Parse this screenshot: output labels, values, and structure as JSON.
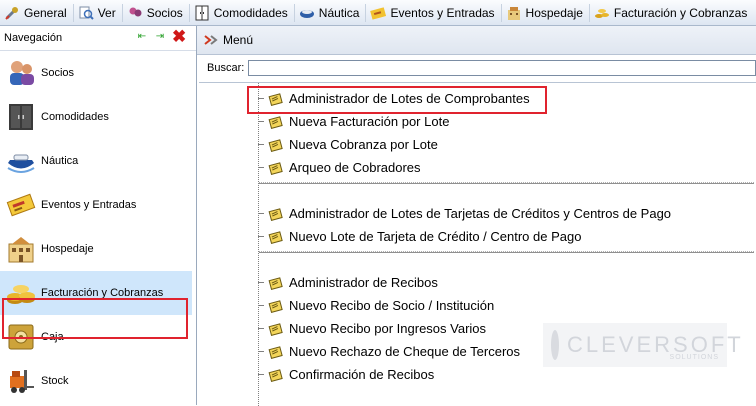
{
  "menubar": {
    "items": [
      {
        "label": "General",
        "icon": "wrench-icon"
      },
      {
        "label": "Ver",
        "icon": "magnifier-icon"
      },
      {
        "label": "Socios",
        "icon": "members-icon"
      },
      {
        "label": "Comodidades",
        "icon": "wardrobe-icon"
      },
      {
        "label": "Náutica",
        "icon": "boat-icon"
      },
      {
        "label": "Eventos y Entradas",
        "icon": "ticket-icon"
      },
      {
        "label": "Hospedaje",
        "icon": "hotel-icon"
      },
      {
        "label": "Facturación y Cobranzas",
        "icon": "coins-icon"
      }
    ]
  },
  "nav": {
    "title": "Navegación",
    "items": [
      {
        "label": "Socios",
        "icon": "members-icon"
      },
      {
        "label": "Comodidades",
        "icon": "wardrobe-icon"
      },
      {
        "label": "Náutica",
        "icon": "boat-icon"
      },
      {
        "label": "Eventos y Entradas",
        "icon": "ticket-icon"
      },
      {
        "label": "Hospedaje",
        "icon": "hotel-icon"
      },
      {
        "label": "Facturación y Cobranzas",
        "icon": "coins-icon",
        "selected": true
      },
      {
        "label": "Caja",
        "icon": "safe-icon"
      },
      {
        "label": "Stock",
        "icon": "forklift-icon"
      }
    ]
  },
  "main": {
    "title": "Menú",
    "search_label": "Buscar:",
    "search_value": "",
    "groups": [
      [
        "Administrador de Lotes de Comprobantes",
        "Nueva Facturación por Lote",
        "Nueva Cobranza por Lote",
        "Arqueo de Cobradores"
      ],
      [
        "Administrador de Lotes de Tarjetas de Créditos y Centros de Pago",
        "Nuevo Lote de Tarjeta de Crédito / Centro de Pago"
      ],
      [
        "Administrador de Recibos",
        "Nuevo Recibo de Socio / Institución",
        "Nuevo Recibo por Ingresos Varios",
        "Nuevo Rechazo de Cheque de Terceros",
        "Confirmación de Recibos"
      ]
    ],
    "highlighted_item": "Administrador de Lotes de Comprobantes"
  },
  "watermark": {
    "brand": "CLEVERSOFT",
    "tagline": "SOLUTIONS"
  },
  "colors": {
    "highlight": "#e0232e",
    "selected_bg": "#cfe6fb"
  }
}
